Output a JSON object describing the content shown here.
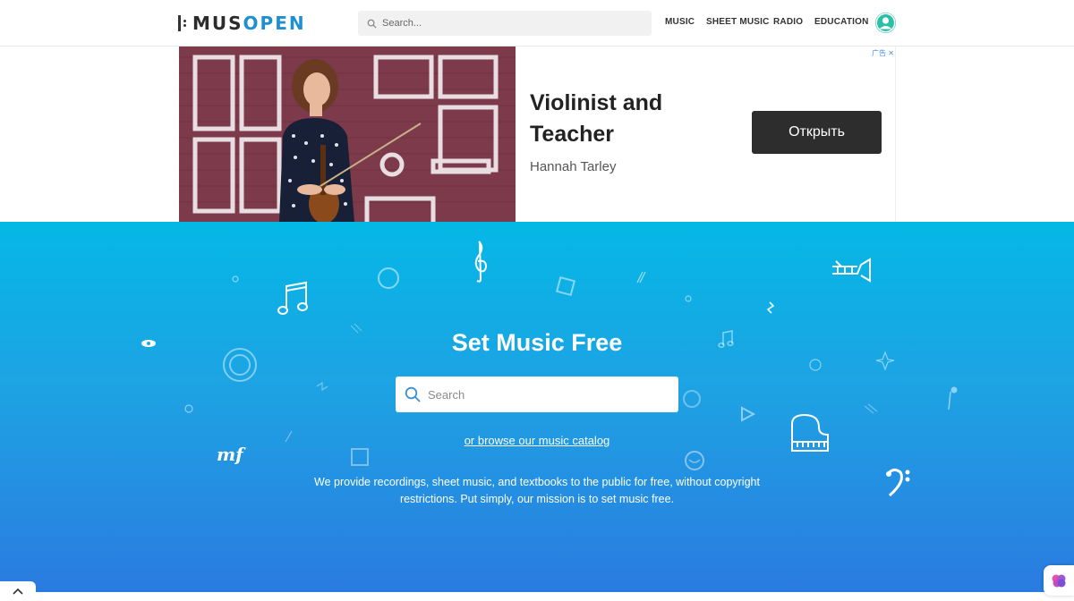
{
  "header": {
    "logo_part1": "MUS",
    "logo_part2": "OPEN",
    "search_placeholder": "Search...",
    "nav": [
      "MUSIC",
      "SHEET MUSIC",
      "RADIO",
      "EDUCATION"
    ]
  },
  "ad": {
    "title": "Violinist and Teacher",
    "subtitle": "Hannah Tarley",
    "button": "Открыть",
    "choices": "广告 ✕"
  },
  "hero": {
    "title": "Set Music Free",
    "search_placeholder": "Search",
    "browse_link": "or browse our music catalog",
    "mission": "We provide recordings, sheet music, and textbooks to the public for free, without copyright restrictions. Put simply, our mission is to set music free.",
    "dynamic_mark": "mf"
  },
  "colors": {
    "brand_blue": "#1e8fd0",
    "hero_top": "#04b8e6",
    "hero_bottom": "#2b79e0",
    "avatar": "#2bbfa7"
  }
}
